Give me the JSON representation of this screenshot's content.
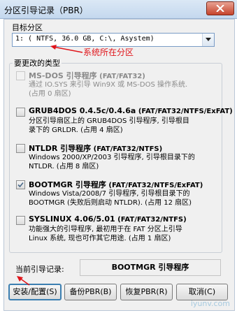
{
  "window": {
    "title": "分区引导记录（PBR）"
  },
  "target": {
    "label": "目标分区",
    "selected": "1: ( NTFS, 36.0 GB, C:\\, Asystem)",
    "annotation": "系统所在分区"
  },
  "types": {
    "label": "要更改的类型",
    "options": [
      {
        "name": "MS-DOS 引导程序",
        "fs": "(FAT/FAT32)",
        "desc": "通过 IO.SYS 来引导 Win9X 或 MS-DOS 操作系统.\n(占用 0 扇区)",
        "checked": false,
        "enabled": false
      },
      {
        "name": "GRUB4DOS 0.4.5c/0.4.6a",
        "fs": "(FAT/FAT32/NTFS/ExFAT)",
        "desc": "分区引导扇区上的 GRUB4DOS 引导程序, 引导根目\n录下的 GRLDR. (占用 4 扇区)",
        "checked": false,
        "enabled": true
      },
      {
        "name": "NTLDR 引导程序",
        "fs": "(FAT/FAT32/NTFS)",
        "desc": "Windows 2000/XP/2003 引导程序, 引导根目录下的\nNTLDR. (占用 8 扇区)",
        "checked": false,
        "enabled": true
      },
      {
        "name": "BOOTMGR 引导程序",
        "fs": "(FAT/FAT32/NTFS/ExFAT)",
        "desc": "Windows Vista/2008/7 引导程序, 引导根目录下的\nBOOTMGR (失败后则启动 NTLDR). (占用 12 扇区)",
        "checked": true,
        "enabled": true
      },
      {
        "name": "SYSLINUX 4.06/5.01",
        "fs": "(FAT/FAT32/NTFS)",
        "desc": "功能强大的引导程序, 最初用于在 FAT 分区上引导\nLinux 系统, 现也可作其它用途. (占用 1 扇区)",
        "checked": false,
        "enabled": true
      }
    ]
  },
  "current": {
    "label": "当前引导记录:",
    "value": "BOOTMGR 引导程序"
  },
  "buttons": {
    "install": "安装/配置(S)",
    "backup": "备份PBR(B)",
    "restore": "恢复PBR(R)",
    "cancel": "取消(C)"
  },
  "watermark": "iyunv.com",
  "colors": {
    "annotation": "#e0141a",
    "default_button_border": "#3c7fb1"
  }
}
